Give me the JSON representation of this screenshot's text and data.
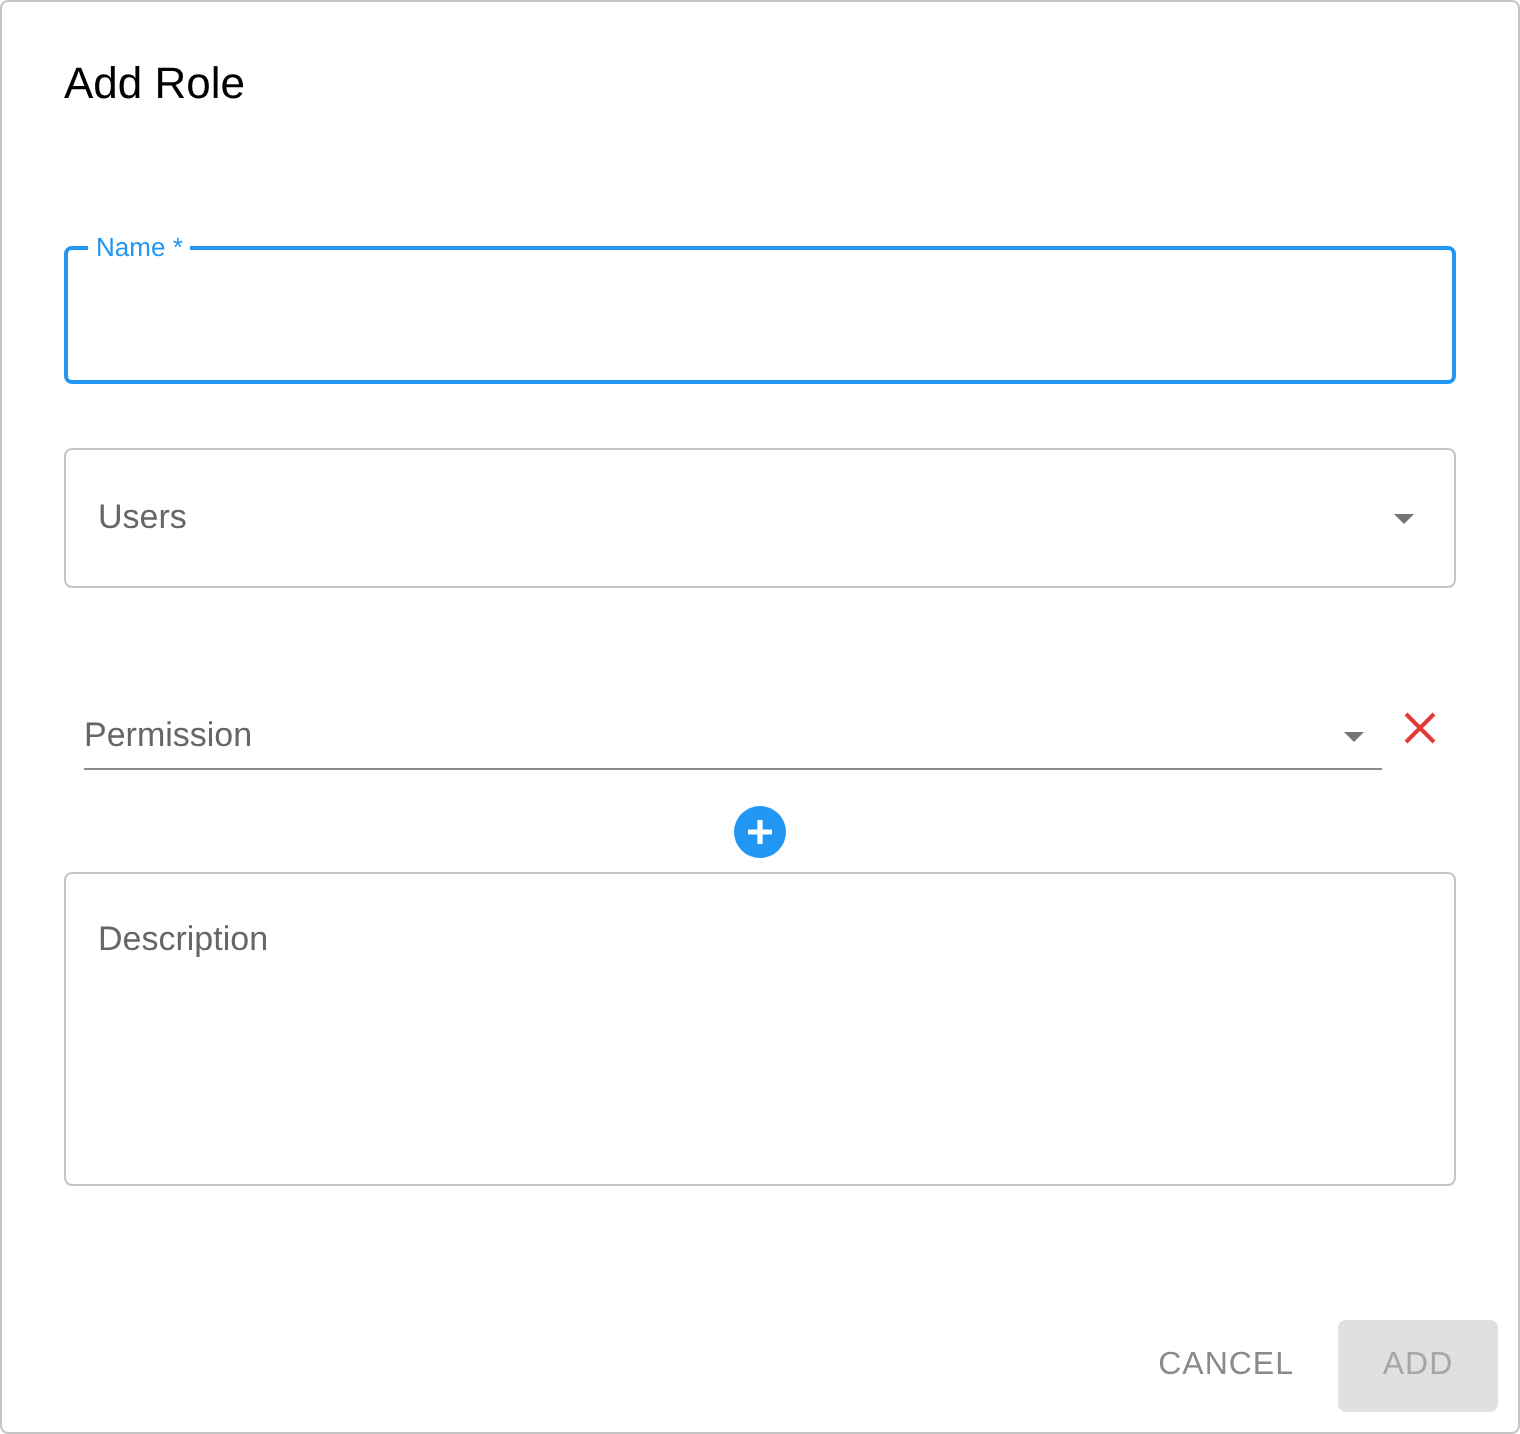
{
  "dialog": {
    "title": "Add Role"
  },
  "fields": [
    {
      "kind": "text",
      "label": "Name",
      "required_mark": "*",
      "focused": true
    },
    {
      "kind": "select",
      "label": "Users",
      "focused": false
    }
  ],
  "permissions": [
    {
      "label": "Permission"
    }
  ],
  "description": {
    "label": "Description"
  },
  "buttons": [
    {
      "label": "CANCEL",
      "kind": "text",
      "disabled": false
    },
    {
      "label": "ADD",
      "kind": "contained",
      "disabled": true
    }
  ]
}
